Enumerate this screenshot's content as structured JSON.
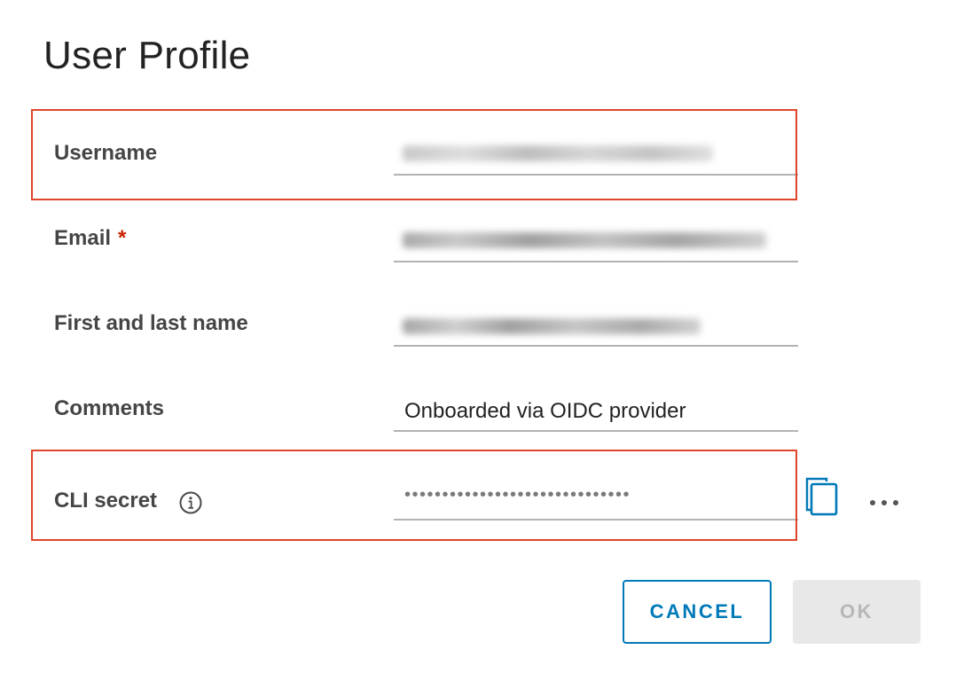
{
  "dialog": {
    "title": "User Profile"
  },
  "form": {
    "username": {
      "label": "Username",
      "value_blurred": true
    },
    "email": {
      "label": "Email",
      "required_marker": "*",
      "value_blurred": true
    },
    "full_name": {
      "label": "First and last name",
      "value_blurred": true
    },
    "comments": {
      "label": "Comments",
      "value": "Onboarded via OIDC provider"
    },
    "cli_secret": {
      "label": "CLI secret",
      "masked_value": "••••••••••••••••••••••••••••••"
    }
  },
  "icons": {
    "info": "info-circle-icon",
    "copy": "copy-icon",
    "more": "ellipsis-horizontal-icon"
  },
  "buttons": {
    "cancel": "CANCEL",
    "ok": "OK"
  },
  "colors": {
    "highlight_border": "#e0442a",
    "primary": "#0079b8",
    "required": "#c92100",
    "disabled_bg": "#e8e8e8",
    "disabled_text": "#b7b7b7"
  }
}
